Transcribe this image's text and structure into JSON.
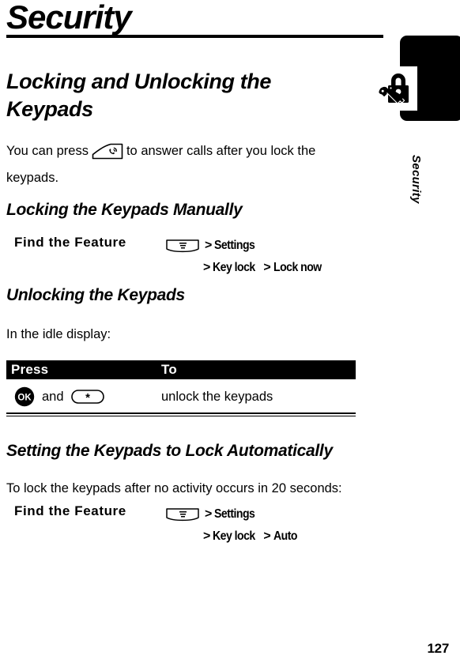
{
  "page": {
    "chapter_title": "Security",
    "page_number": "127",
    "tab_label": "Security",
    "tab_icon": "padlock-and-key-icon"
  },
  "sections": {
    "main_heading": "Locking and Unlocking the Keypads",
    "intro": {
      "before_key": "You can press",
      "key_icon": "send-key-icon",
      "after_key": "to answer calls after you lock the keypads."
    },
    "locking_manually": {
      "heading": "Locking the Keypads Manually",
      "find_the_feature": {
        "label": "Find the Feature",
        "menu_key_icon": "menu-key-icon",
        "separator": ">",
        "line1_item": "Settings",
        "line2_item1": "Key lock",
        "line2_item2": "Lock now"
      }
    },
    "unlocking": {
      "heading": "Unlocking the Keypads",
      "intro": "In the idle display:",
      "table": {
        "headers": [
          "Press",
          "To"
        ],
        "rows": [
          {
            "press_key1_icon": "ok-key-icon",
            "press_key1_label": "OK",
            "conjunction": "and",
            "press_key2_icon": "star-key-icon",
            "press_key2_label": "*",
            "to": "unlock the keypads"
          }
        ]
      }
    },
    "auto_lock": {
      "heading": "Setting the Keypads to Lock Automatically",
      "intro": "To lock the keypads after no activity occurs in 20 seconds:",
      "find_the_feature": {
        "label": "Find the Feature",
        "menu_key_icon": "menu-key-icon",
        "separator": ">",
        "line1_item": "Settings",
        "line2_item1": "Key lock",
        "line2_item2": "Auto"
      }
    }
  },
  "colors": {
    "ink": "#000000",
    "paper": "#ffffff"
  }
}
